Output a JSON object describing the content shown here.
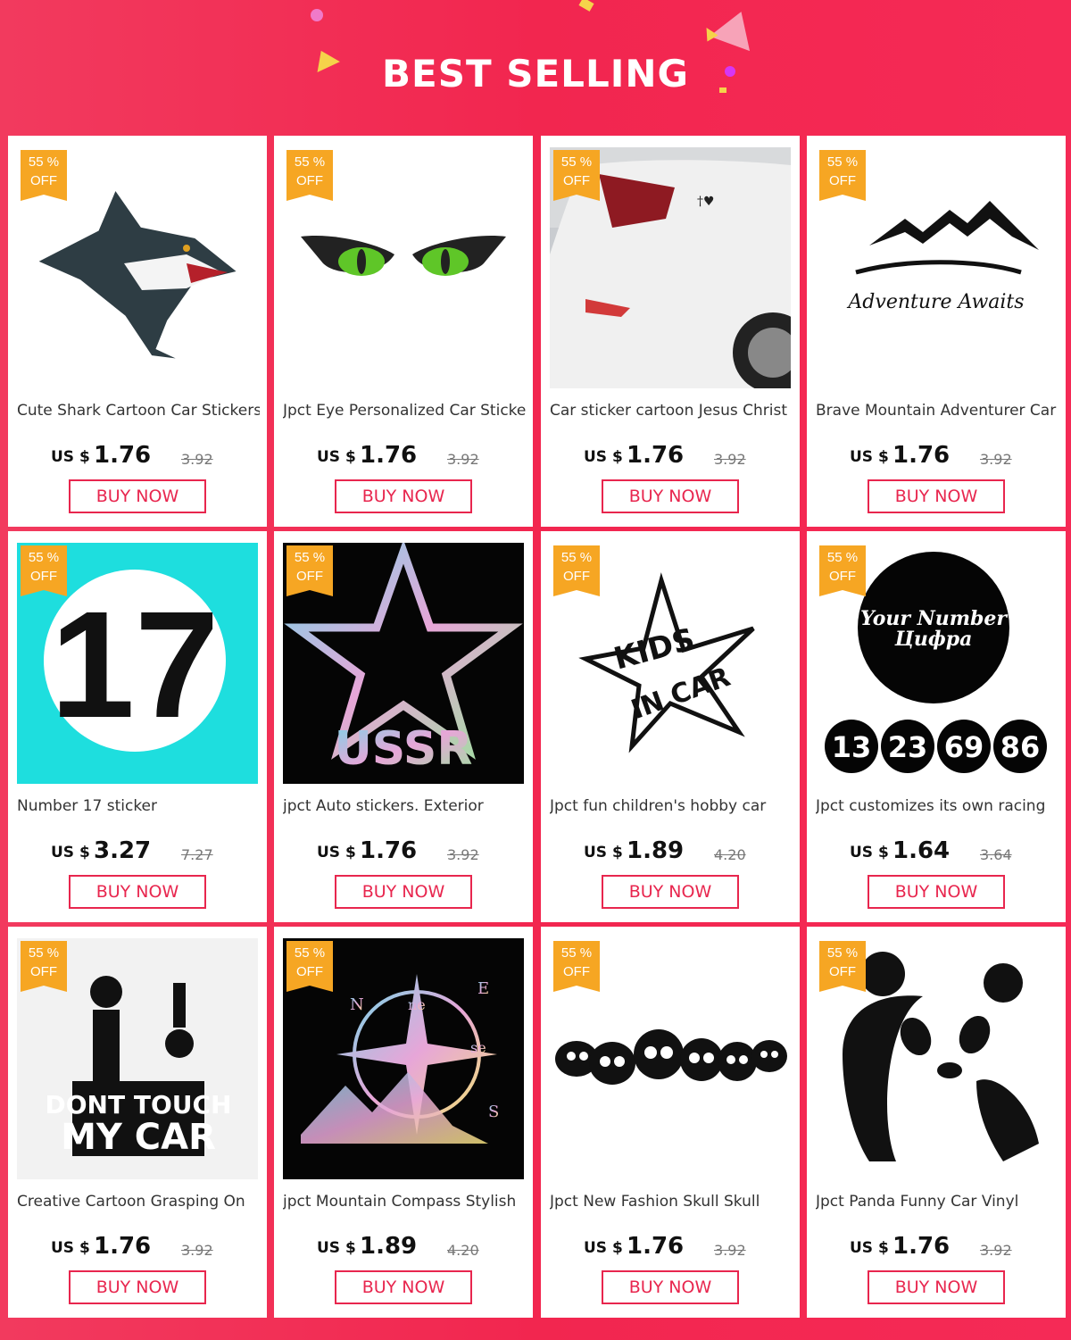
{
  "header": {
    "title": "BEST SELLING"
  },
  "colors": {
    "accent": "#e8264e",
    "badge": "#f6a623",
    "background": "#f2264f"
  },
  "products": [
    {
      "image": "shark-sticker-image",
      "badge_pct": "55 %",
      "badge_off": "OFF",
      "title": "Cute Shark Cartoon Car Stickers",
      "currency": "US $",
      "price": "1.76",
      "old_price": "3.92",
      "button": "BUY NOW"
    },
    {
      "image": "eyes-sticker-image",
      "badge_pct": "55 %",
      "badge_off": "OFF",
      "title": "Jpct Eye Personalized Car Sticker",
      "currency": "US $",
      "price": "1.76",
      "old_price": "3.92",
      "button": "BUY NOW"
    },
    {
      "image": "car-faith-sticker-image",
      "badge_pct": "55 %",
      "badge_off": "OFF",
      "title": "Car sticker cartoon Jesus Christ",
      "currency": "US $",
      "price": "1.76",
      "old_price": "3.92",
      "button": "BUY NOW"
    },
    {
      "image": "mountain-sticker-image",
      "badge_pct": "55 %",
      "badge_off": "OFF",
      "title": "Brave Mountain Adventurer Car",
      "currency": "US $",
      "price": "1.76",
      "old_price": "3.92",
      "button": "BUY NOW"
    },
    {
      "image": "number-17-sticker-image",
      "badge_pct": "55 %",
      "badge_off": "OFF",
      "title": "Number 17 sticker",
      "currency": "US $",
      "price": "3.27",
      "old_price": "7.27",
      "button": "BUY NOW"
    },
    {
      "image": "ussr-star-sticker-image",
      "badge_pct": "55 %",
      "badge_off": "OFF",
      "title": "jpct Auto stickers. Exterior",
      "currency": "US $",
      "price": "1.76",
      "old_price": "3.92",
      "button": "BUY NOW"
    },
    {
      "image": "kids-in-car-sticker-image",
      "badge_pct": "55 %",
      "badge_off": "OFF",
      "title": "Jpct fun children's hobby car",
      "currency": "US $",
      "price": "1.89",
      "old_price": "4.20",
      "button": "BUY NOW"
    },
    {
      "image": "racing-number-sticker-image",
      "badge_pct": "55 %",
      "badge_off": "OFF",
      "title": "Jpct customizes its own racing",
      "currency": "US $",
      "price": "1.64",
      "old_price": "3.64",
      "button": "BUY NOW"
    },
    {
      "image": "dont-touch-sticker-image",
      "badge_pct": "55 %",
      "badge_off": "OFF",
      "title": "Creative Cartoon Grasping On",
      "currency": "US $",
      "price": "1.76",
      "old_price": "3.92",
      "button": "BUY NOW"
    },
    {
      "image": "compass-sticker-image",
      "badge_pct": "55 %",
      "badge_off": "OFF",
      "title": "jpct Mountain Compass Stylish",
      "currency": "US $",
      "price": "1.89",
      "old_price": "4.20",
      "button": "BUY NOW"
    },
    {
      "image": "skull-sticker-image",
      "badge_pct": "55 %",
      "badge_off": "OFF",
      "title": "Jpct New Fashion Skull Skull",
      "currency": "US $",
      "price": "1.76",
      "old_price": "3.92",
      "button": "BUY NOW"
    },
    {
      "image": "panda-sticker-image",
      "badge_pct": "55 %",
      "badge_off": "OFF",
      "title": "Jpct Panda Funny Car Vinyl",
      "currency": "US $",
      "price": "1.76",
      "old_price": "3.92",
      "button": "BUY NOW"
    }
  ],
  "image_text": {
    "mountain": "Adventure Awaits",
    "number17": "17",
    "ussr": "USSR",
    "kids1": "KIDS",
    "kids2": "IN CAR",
    "racing1": "Your Number",
    "racing2": "Цифра",
    "racing_nums": [
      "13",
      "23",
      "69",
      "86"
    ],
    "dont1": "DONT TOUCH",
    "dont2": "MY CAR",
    "compass": [
      "N",
      "ne",
      "E",
      "se",
      "S"
    ]
  }
}
